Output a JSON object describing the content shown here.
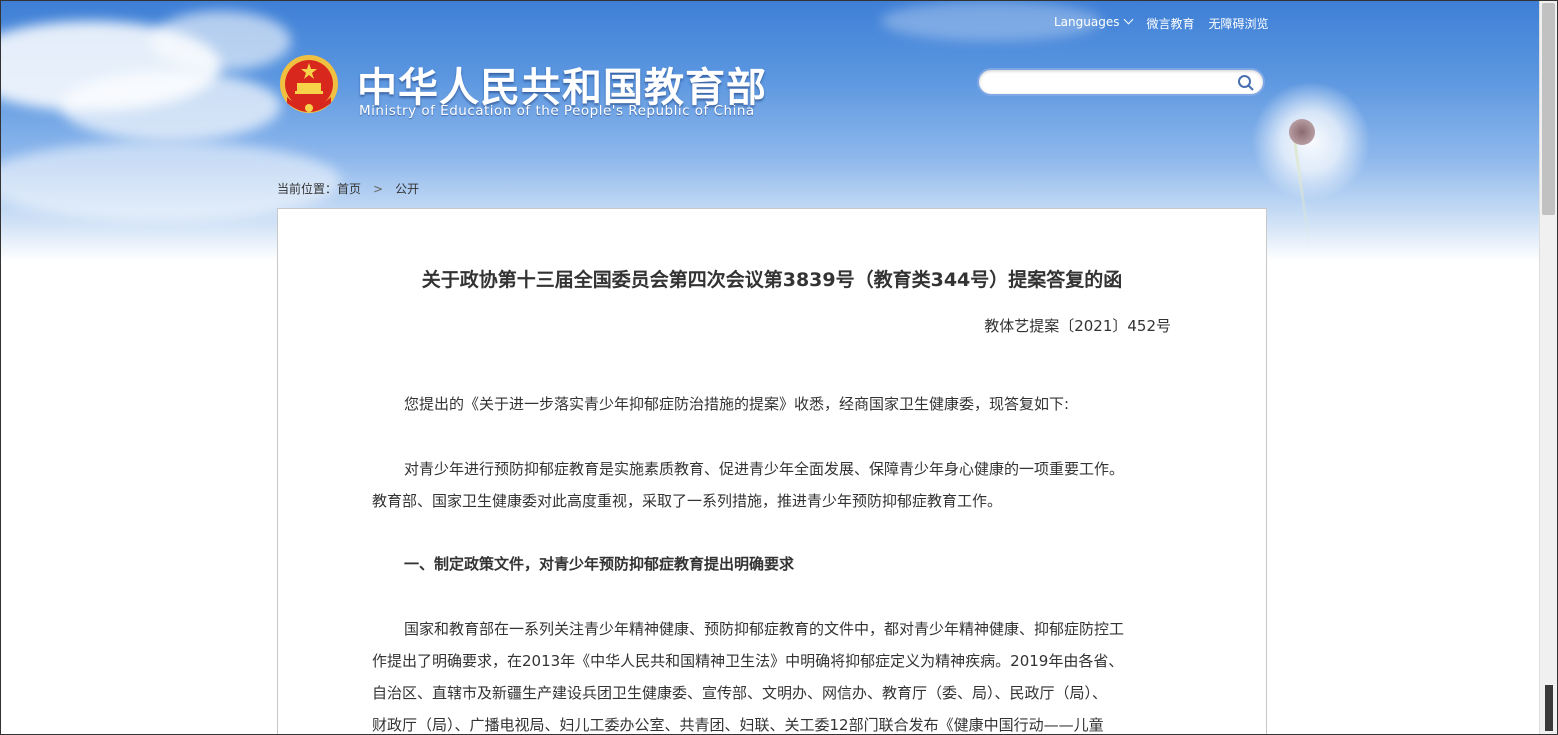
{
  "top_nav": {
    "languages": "Languages",
    "weiyan": "微言教育",
    "accessible": "无障碍浏览"
  },
  "site": {
    "name_cn": "中华人民共和国教育部",
    "name_en": "Ministry of Education of the People's Republic of China"
  },
  "search": {
    "value": "",
    "placeholder": ""
  },
  "breadcrumb": {
    "label": "当前位置：",
    "home": "首页",
    "current": "公开"
  },
  "document": {
    "title": "关于政协第十三届全国委员会第四次会议第3839号（教育类344号）提案答复的函",
    "number": "教体艺提案〔2021〕452号",
    "p1": "您提出的《关于进一步落实青少年抑郁症防治措施的提案》收悉，经商国家卫生健康委，现答复如下:",
    "p2_line1": "对青少年进行预防抑郁症教育是实施素质教育、促进青少年全面发展、保障青少年身心健康的一项重要工作。",
    "p2_line2": "教育部、国家卫生健康委对此高度重视，采取了一系列措施，推进青少年预防抑郁症教育工作。",
    "heading1": "一、制定政策文件，对青少年预防抑郁症教育提出明确要求",
    "p3_line1": "国家和教育部在一系列关注青少年精神健康、预防抑郁症教育的文件中，都对青少年精神健康、抑郁症防控工",
    "p3_line2": "作提出了明确要求，在2013年《中华人民共和国精神卫生法》中明确将抑郁症定义为精神疾病。2019年由各省、",
    "p3_line3": "自治区、直辖市及新疆生产建设兵团卫生健康委、宣传部、文明办、网信办、教育厅（委、局）、民政厅（局）、",
    "p3_line4": "财政厅（局）、广播电视局、妇儿工委办公室、共青团、妇联、关工委12部门联合发布《健康中国行动——儿童"
  }
}
